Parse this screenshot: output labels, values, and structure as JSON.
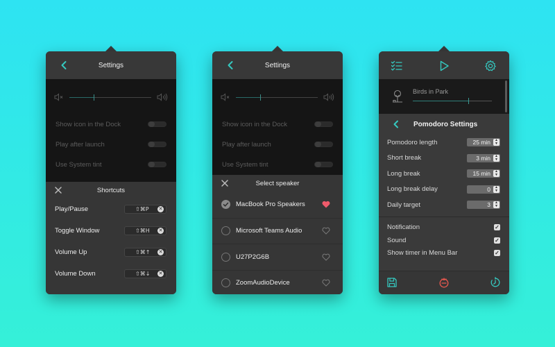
{
  "panel_settings": {
    "title": "Settings",
    "volume": {
      "level": 0.3
    },
    "options": [
      {
        "label": "Show icon in the Dock"
      },
      {
        "label": "Play after launch"
      },
      {
        "label": "Use System tint"
      }
    ]
  },
  "panel_shortcuts": {
    "title": "Shortcuts",
    "rows": [
      {
        "label": "Play/Pause",
        "keys": "⇧⌘P"
      },
      {
        "label": "Toggle Window",
        "keys": "⇧⌘H"
      },
      {
        "label": "Volume Up",
        "keys": "⇧⌘↑"
      },
      {
        "label": "Volume Down",
        "keys": "⇧⌘↓"
      }
    ]
  },
  "panel_speaker": {
    "title": "Select speaker",
    "speakers": [
      {
        "name": "MacBook Pro Speakers",
        "selected": true,
        "favorite": true
      },
      {
        "name": "Microsoft Teams Audio",
        "selected": false,
        "favorite": false
      },
      {
        "name": "U27P2G6B",
        "selected": false,
        "favorite": false
      },
      {
        "name": "ZoomAudioDevice",
        "selected": false,
        "favorite": false
      }
    ]
  },
  "panel_pomodoro": {
    "ambient_name": "Birds in Park",
    "ambient_level": 0.7,
    "title": "Pomodoro Settings",
    "fields": [
      {
        "label": "Pomodoro length",
        "value": "25 min"
      },
      {
        "label": "Short break",
        "value": "3 min"
      },
      {
        "label": "Long break",
        "value": "15 min"
      },
      {
        "label": "Long break delay",
        "value": "0"
      },
      {
        "label": "Daily target",
        "value": "3"
      }
    ],
    "checks": [
      {
        "label": "Notification",
        "checked": true
      },
      {
        "label": "Sound",
        "checked": true
      },
      {
        "label": "Show timer in Menu Bar",
        "checked": true
      }
    ]
  },
  "colors": {
    "accent": "#35c9c0",
    "heart": "#ef5b6b",
    "tomato": "#e8584f"
  }
}
